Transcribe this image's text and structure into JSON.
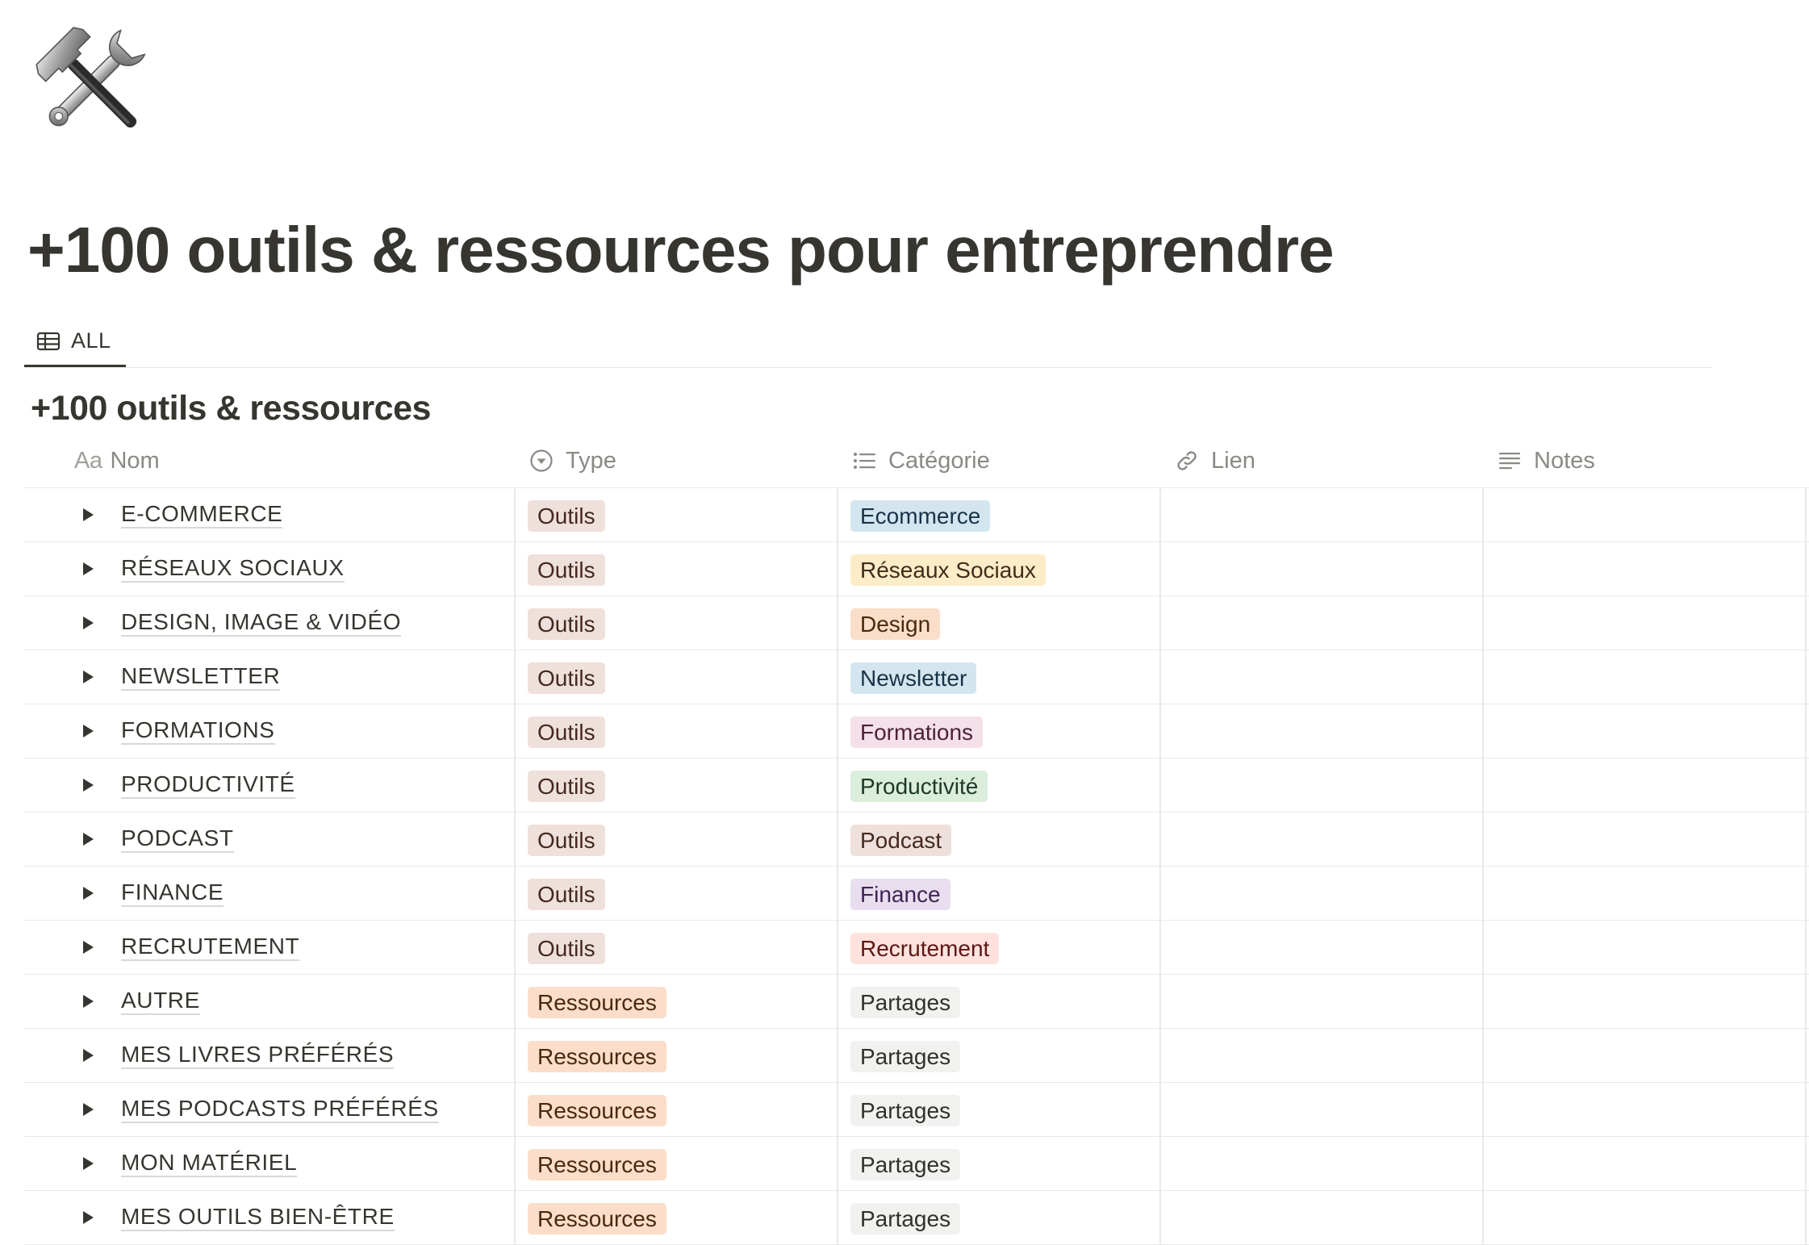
{
  "page": {
    "icon": "hammer-and-wrench-icon",
    "title": "+100 outils & ressources pour entreprendre"
  },
  "views": [
    {
      "label": "ALL",
      "icon": "table-icon"
    }
  ],
  "database": {
    "title": "+100 outils & ressources",
    "columns": [
      {
        "label": "Nom",
        "icon": "title-aa-icon",
        "prefix": "Aa"
      },
      {
        "label": "Type",
        "icon": "select-icon"
      },
      {
        "label": "Catégorie",
        "icon": "list-icon"
      },
      {
        "label": "Lien",
        "icon": "link-icon"
      },
      {
        "label": "Notes",
        "icon": "text-icon"
      }
    ],
    "rows": [
      {
        "name": "E-COMMERCE",
        "type": "Outils",
        "category": "Ecommerce"
      },
      {
        "name": "RÉSEAUX SOCIAUX",
        "type": "Outils",
        "category": "Réseaux Sociaux"
      },
      {
        "name": "DESIGN, IMAGE & VIDÉO",
        "type": "Outils",
        "category": "Design"
      },
      {
        "name": "NEWSLETTER",
        "type": "Outils",
        "category": "Newsletter"
      },
      {
        "name": "FORMATIONS",
        "type": "Outils",
        "category": "Formations"
      },
      {
        "name": "PRODUCTIVITÉ",
        "type": "Outils",
        "category": "Productivité"
      },
      {
        "name": "PODCAST",
        "type": "Outils",
        "category": "Podcast"
      },
      {
        "name": "FINANCE",
        "type": "Outils",
        "category": "Finance"
      },
      {
        "name": "RECRUTEMENT",
        "type": "Outils",
        "category": "Recrutement"
      },
      {
        "name": "AUTRE",
        "type": "Ressources",
        "category": "Partages"
      },
      {
        "name": "MES LIVRES PRÉFÉRÉS",
        "type": "Ressources",
        "category": "Partages"
      },
      {
        "name": "MES PODCASTS PRÉFÉRÉS",
        "type": "Ressources",
        "category": "Partages"
      },
      {
        "name": "MON MATÉRIEL",
        "type": "Ressources",
        "category": "Partages"
      },
      {
        "name": "MES OUTILS BIEN-ÊTRE",
        "type": "Ressources",
        "category": "Partages"
      }
    ]
  },
  "tag_colors": {
    "Outils": {
      "bg": "#eee0da",
      "fg": "#44291f"
    },
    "Ressources": {
      "bg": "#fadec9",
      "fg": "#49290e"
    },
    "Ecommerce": {
      "bg": "#d3e5ef",
      "fg": "#183347"
    },
    "Réseaux Sociaux": {
      "bg": "#fdecc8",
      "fg": "#402c1b"
    },
    "Design": {
      "bg": "#fadec9",
      "fg": "#49290e"
    },
    "Newsletter": {
      "bg": "#d3e5ef",
      "fg": "#183347"
    },
    "Formations": {
      "bg": "#f5e0e9",
      "fg": "#4c2337"
    },
    "Productivité": {
      "bg": "#dbeddb",
      "fg": "#1c3829"
    },
    "Podcast": {
      "bg": "#eee0da",
      "fg": "#44291f"
    },
    "Finance": {
      "bg": "#e8deee",
      "fg": "#412454"
    },
    "Recrutement": {
      "bg": "#ffe2dd",
      "fg": "#5d1715"
    },
    "Partages": {
      "bg": "#f1f1ef",
      "fg": "#32302c"
    }
  }
}
